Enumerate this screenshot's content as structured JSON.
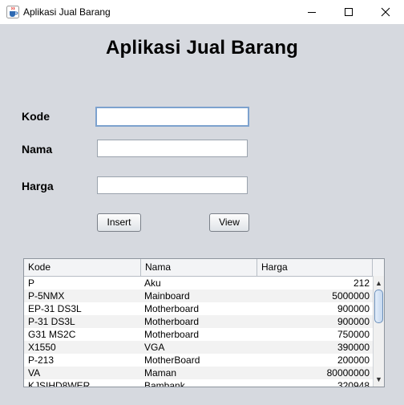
{
  "window": {
    "title": "Aplikasi Jual Barang",
    "icon": "java-cup-icon"
  },
  "form": {
    "heading": "Aplikasi Jual Barang",
    "kode_label": "Kode",
    "nama_label": "Nama",
    "harga_label": "Harga",
    "kode_value": "",
    "nama_value": "",
    "harga_value": "",
    "insert_label": "Insert",
    "view_label": "View"
  },
  "table": {
    "columns": [
      "Kode",
      "Nama",
      "Harga"
    ],
    "rows": [
      {
        "kode": "P",
        "nama": "Aku",
        "harga": "212"
      },
      {
        "kode": "P-5NMX",
        "nama": "Mainboard",
        "harga": "5000000"
      },
      {
        "kode": "EP-31 DS3L",
        "nama": "Motherboard",
        "harga": "900000"
      },
      {
        "kode": "P-31 DS3L",
        "nama": "Motherboard",
        "harga": "900000"
      },
      {
        "kode": "G31 MS2C",
        "nama": "Motherboard",
        "harga": "750000"
      },
      {
        "kode": "X1550",
        "nama": "VGA",
        "harga": "390000"
      },
      {
        "kode": "P-213",
        "nama": "MotherBoard",
        "harga": "200000"
      },
      {
        "kode": "VA",
        "nama": "Maman",
        "harga": "80000000"
      },
      {
        "kode": "KJSIHD8WER",
        "nama": "Bambank",
        "harga": "320948"
      }
    ]
  },
  "colors": {
    "client_bg": "#d6d9df",
    "focus_border": "#7da2ce"
  }
}
